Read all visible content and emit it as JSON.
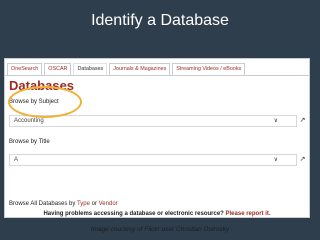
{
  "slide": {
    "title": "Identify a Database",
    "caption": "Image courtesy of Flickr user Christian Ostrosky"
  },
  "tabs": [
    {
      "label": "OneSearch",
      "active": false
    },
    {
      "label": "OSCAR",
      "active": false
    },
    {
      "label": "Databases",
      "active": true
    },
    {
      "label": "Journals & Magazines",
      "active": false
    },
    {
      "label": "Streaming Videos / eBooks",
      "active": false
    }
  ],
  "databases": {
    "heading": "Databases",
    "browse_subject_label": "Browse by Subject",
    "subject_value": "Accounting",
    "browse_title_label": "Browse by Title",
    "title_value": "A",
    "browse_all_prefix": "Browse All Databases by",
    "type_link": "Type",
    "or_text": "or",
    "vendor_link": "Vendor",
    "problem_text": "Having problems accessing a database or electronic resource?",
    "report_link": "Please report it."
  },
  "icons": {
    "chevron": "chevron-down-icon",
    "go": "external-link-icon"
  },
  "colors": {
    "brand": "#9b2b24",
    "highlight": "#f2b134",
    "background": "#2f3e4c"
  }
}
